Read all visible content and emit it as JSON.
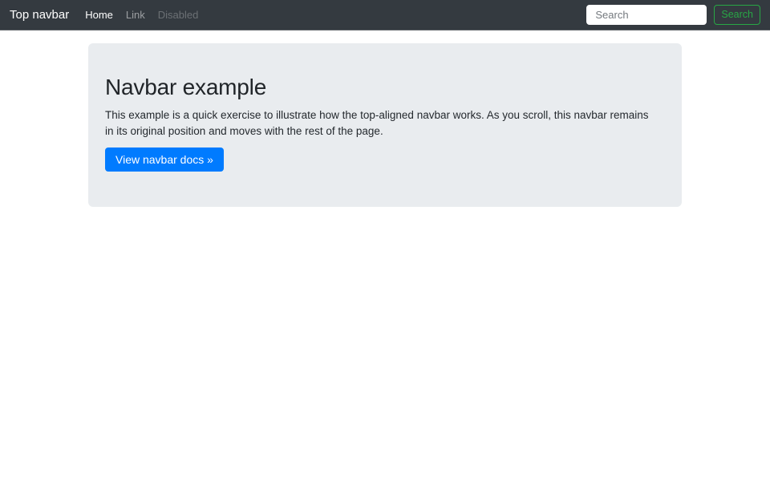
{
  "navbar": {
    "brand": "Top navbar",
    "links": [
      {
        "label": "Home",
        "state": "active"
      },
      {
        "label": "Link",
        "state": "normal"
      },
      {
        "label": "Disabled",
        "state": "disabled"
      }
    ],
    "search": {
      "placeholder": "Search",
      "button_label": "Search"
    }
  },
  "main": {
    "title": "Navbar example",
    "description": "This example is a quick exercise to illustrate how the top-aligned navbar works. As you scroll, this navbar remains in its original position and moves with the rest of the page.",
    "cta_label": "View navbar docs »"
  },
  "colors": {
    "navbar_bg": "#343a40",
    "panel_bg": "#e9ecef",
    "primary": "#007bff",
    "success_outline": "#28a745",
    "heading_text": "#212529"
  }
}
